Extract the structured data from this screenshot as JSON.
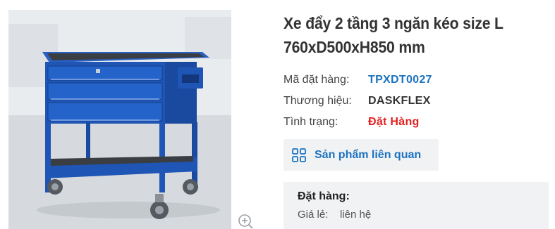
{
  "product": {
    "title_line1": "Xe đẩy 2 tầng 3 ngăn kéo size L",
    "title_line2": "760xD500xH850 mm",
    "image_icon": "tool-cart-image",
    "zoom_icon": "zoom-in-icon"
  },
  "details": {
    "sku_label": "Mã đặt hàng:",
    "sku_value": "TPXDT0027",
    "brand_label": "Thương hiệu:",
    "brand_value": "DASKFLEX",
    "status_label": "Tình trạng:",
    "status_value": "Đặt Hàng"
  },
  "related": {
    "label": "Sản phẩm liên quan",
    "icon": "grid-icon"
  },
  "order": {
    "heading": "Đặt hàng:",
    "price_label": "Giá lẻ:",
    "price_value": "liên hệ"
  },
  "colors": {
    "accent_blue": "#1c73c0",
    "status_red": "#e41e1e",
    "cart_blue": "#1f55b5",
    "panel_bg": "#f1f2f4"
  }
}
